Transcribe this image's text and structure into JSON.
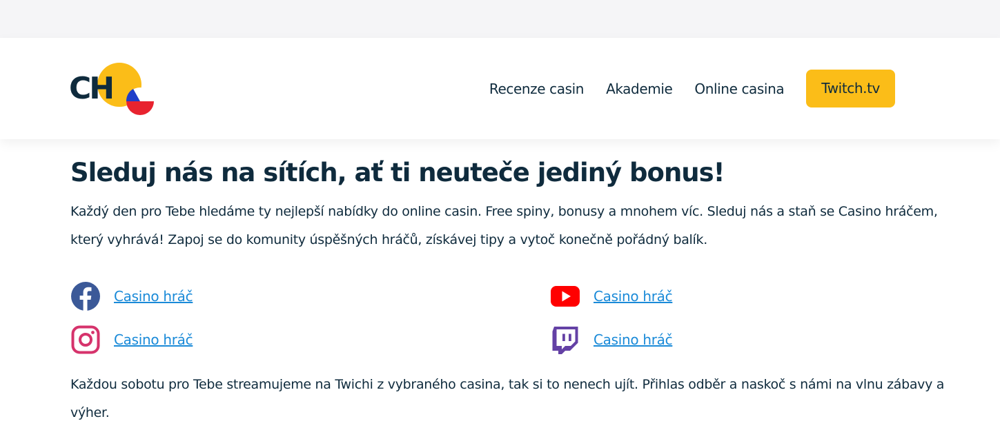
{
  "header": {
    "logo_text": "CH",
    "nav": {
      "items": [
        "Recenze casin",
        "Akademie",
        "Online casina"
      ],
      "cta_label": "Twitch.tv"
    }
  },
  "main": {
    "heading": "Sleduj nás na sítích, ať ti neuteče jediný bonus!",
    "intro": "Každý den pro Tebe hledáme ty nejlepší nabídky do online casin. Free spiny, bonusy a mnohem víc. Sleduj nás a staň se Casino hráčem, který vyhrává! Zapoj se do komunity úspěšných hráčů, získávej tipy a vytoč konečně pořádný balík.",
    "socials": [
      {
        "icon": "facebook-icon",
        "label": "Casino hráč",
        "color": "#3b5998"
      },
      {
        "icon": "youtube-icon",
        "label": "Casino hráč",
        "color": "#ff0000"
      },
      {
        "icon": "instagram-icon",
        "label": "Casino hráč",
        "color": "#d6336c"
      },
      {
        "icon": "twitch-icon",
        "label": "Casino hráč",
        "color": "#6441a5"
      }
    ],
    "outro": "Každou sobotu pro Tebe streamujeme na Twichi z vybraného casina, tak si to nenech ujít. Přihlas odběr a naskoč s námi na vlnu zábavy a výher."
  },
  "colors": {
    "accent": "#fbbd18",
    "text": "#0f2b3d",
    "link": "#1a8ad8",
    "topstrip": "#f5f5f7"
  }
}
